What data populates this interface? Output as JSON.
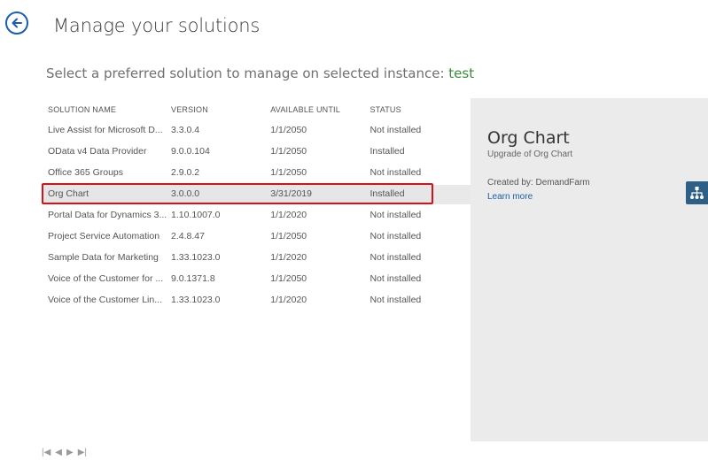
{
  "header": {
    "title": "Manage your solutions",
    "subtitle_prefix": "Select a preferred solution to manage on selected instance: ",
    "instance_name": "test"
  },
  "table": {
    "columns": [
      "SOLUTION NAME",
      "VERSION",
      "AVAILABLE UNTIL",
      "STATUS"
    ],
    "rows": [
      {
        "name": "Live Assist for Microsoft D...",
        "version": "3.3.0.4",
        "available": "1/1/2050",
        "status": "Not installed"
      },
      {
        "name": "OData v4 Data Provider",
        "version": "9.0.0.104",
        "available": "1/1/2050",
        "status": "Installed"
      },
      {
        "name": "Office 365 Groups",
        "version": "2.9.0.2",
        "available": "1/1/2050",
        "status": "Not installed"
      },
      {
        "name": "Org Chart",
        "version": "3.0.0.0",
        "available": "3/31/2019",
        "status": "Installed"
      },
      {
        "name": "Portal Data for Dynamics 3...",
        "version": "1.10.1007.0",
        "available": "1/1/2020",
        "status": "Not installed"
      },
      {
        "name": "Project Service Automation",
        "version": "2.4.8.47",
        "available": "1/1/2050",
        "status": "Not installed"
      },
      {
        "name": "Sample Data for Marketing",
        "version": "1.33.1023.0",
        "available": "1/1/2020",
        "status": "Not installed"
      },
      {
        "name": "Voice of the Customer for ...",
        "version": "9.0.1371.8",
        "available": "1/1/2050",
        "status": "Not installed"
      },
      {
        "name": "Voice of the Customer Lin...",
        "version": "1.33.1023.0",
        "available": "1/1/2020",
        "status": "Not installed"
      }
    ],
    "selected_index": 3
  },
  "details": {
    "name": "Org Chart",
    "upgrade_text": "Upgrade of Org Chart",
    "created_by": "Created by: DemandFarm",
    "learn_more": "Learn more",
    "icon": "org-chart-icon"
  },
  "colors": {
    "accent": "#1a5fa8",
    "selection_border": "#d6111a",
    "instance_text": "#3a8c3a",
    "panel_bg": "#ebebeb",
    "icon_bg": "#2e5f86"
  },
  "icons": [
    "back-arrow-icon",
    "first-page-icon",
    "prev-page-icon",
    "next-page-icon",
    "last-page-icon"
  ]
}
